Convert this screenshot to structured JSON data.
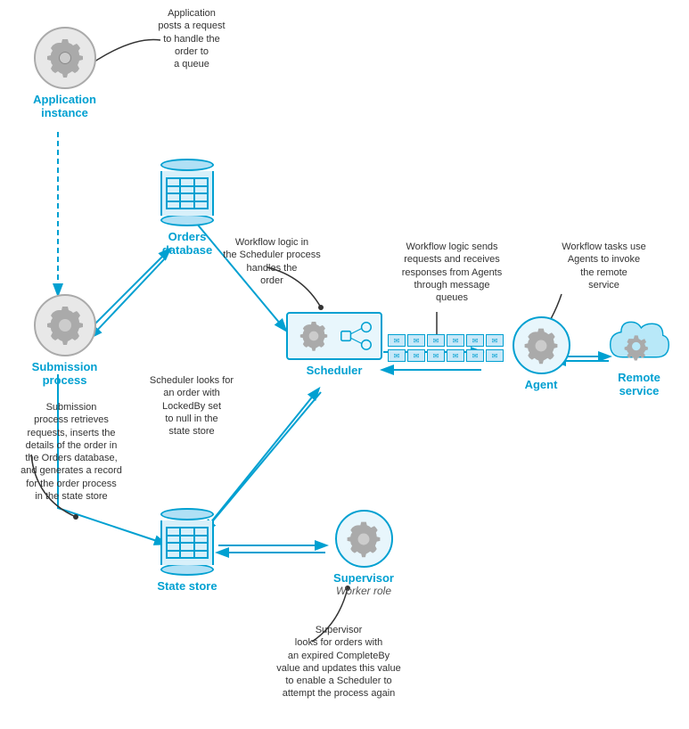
{
  "nodes": {
    "application": {
      "label": "Application\ninstance",
      "label_line1": "Application",
      "label_line2": "instance"
    },
    "submission": {
      "label_line1": "Submission",
      "label_line2": "process"
    },
    "orders_db": {
      "label_line1": "Orders",
      "label_line2": "database"
    },
    "scheduler": {
      "label": "Scheduler"
    },
    "state_store": {
      "label_line1": "State store"
    },
    "supervisor": {
      "label_line1": "Supervisor",
      "label_line2": "Worker role"
    },
    "agent": {
      "label": "Agent"
    },
    "remote_service": {
      "label_line1": "Remote",
      "label_line2": "service"
    }
  },
  "annotations": {
    "app_queue": "Application\nposts a request\nto handle the\norder to\na queue",
    "scheduler_handles": "Workflow logic in\nthe Scheduler process\nhandles the\norder",
    "sends_receives": "Workflow logic sends\nrequests and receives\nresponses from Agents\nthrough message\nqueues",
    "agents_invoke": "Workflow tasks use\nAgents to invoke\nthe remote\nservice",
    "scheduler_looks": "Scheduler looks for\nan order with\nLockedBy set\nto null in the\nstate store",
    "submission_retrieves": "Submission\nprocess retrieves\nrequests, inserts the\ndetails of the order in\nthe Orders database,\nand generates a record\nfor the order process\nin the state store",
    "supervisor_looks": "Supervisor\nlooks for orders with\nan expired CompleteBy\nvalue and updates this value\nto enable a Scheduler to\nattempt the process again"
  },
  "colors": {
    "blue": "#00a0d1",
    "light_blue": "#e8f6fc",
    "gear_gray": "#888888",
    "text_dark": "#333333"
  }
}
